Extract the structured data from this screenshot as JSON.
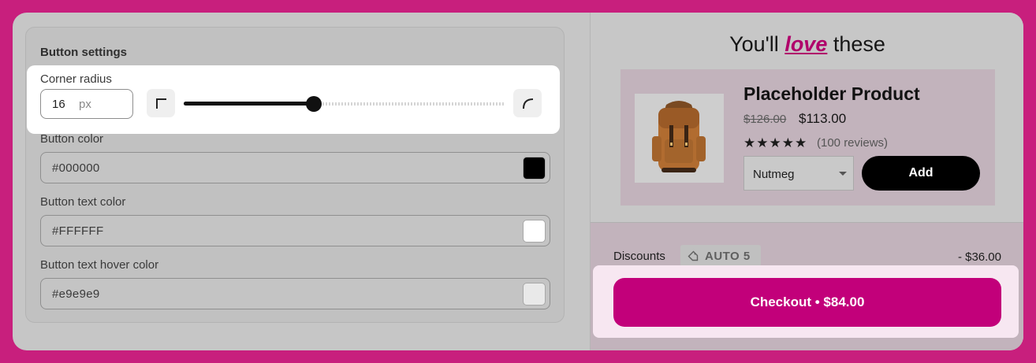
{
  "settings": {
    "title": "Button settings",
    "corner_radius": {
      "label": "Corner radius",
      "value": "16",
      "unit": "px",
      "slider_level": 0.405
    },
    "button_color": {
      "label": "Button color",
      "value": "#000000",
      "swatch": "#000000"
    },
    "button_text_color": {
      "label": "Button text color",
      "value": "#FFFFFF",
      "swatch": "#FFFFFF"
    },
    "button_text_hover_color": {
      "label": "Button text hover color",
      "value": "#e9e9e9",
      "swatch": "#e9e9e9"
    }
  },
  "preview": {
    "heading_pre": "You'll",
    "heading_em": "love",
    "heading_post": "these",
    "product": {
      "name": "Placeholder Product",
      "price_old": "$126.00",
      "price_new": "$113.00",
      "stars": "★★★★★",
      "rating": 4.5,
      "reviews": "(100 reviews)",
      "variant": "Nutmeg",
      "add_label": "Add"
    },
    "summary": {
      "discounts_label": "Discounts",
      "discount_code": "AUTO 5",
      "discount_amount": "- $36.00",
      "checkout_label": "Checkout • $84.00"
    }
  },
  "colors": {
    "background": "#c81f7d",
    "accent": "#c2007a",
    "love_text": "#b0006a"
  }
}
